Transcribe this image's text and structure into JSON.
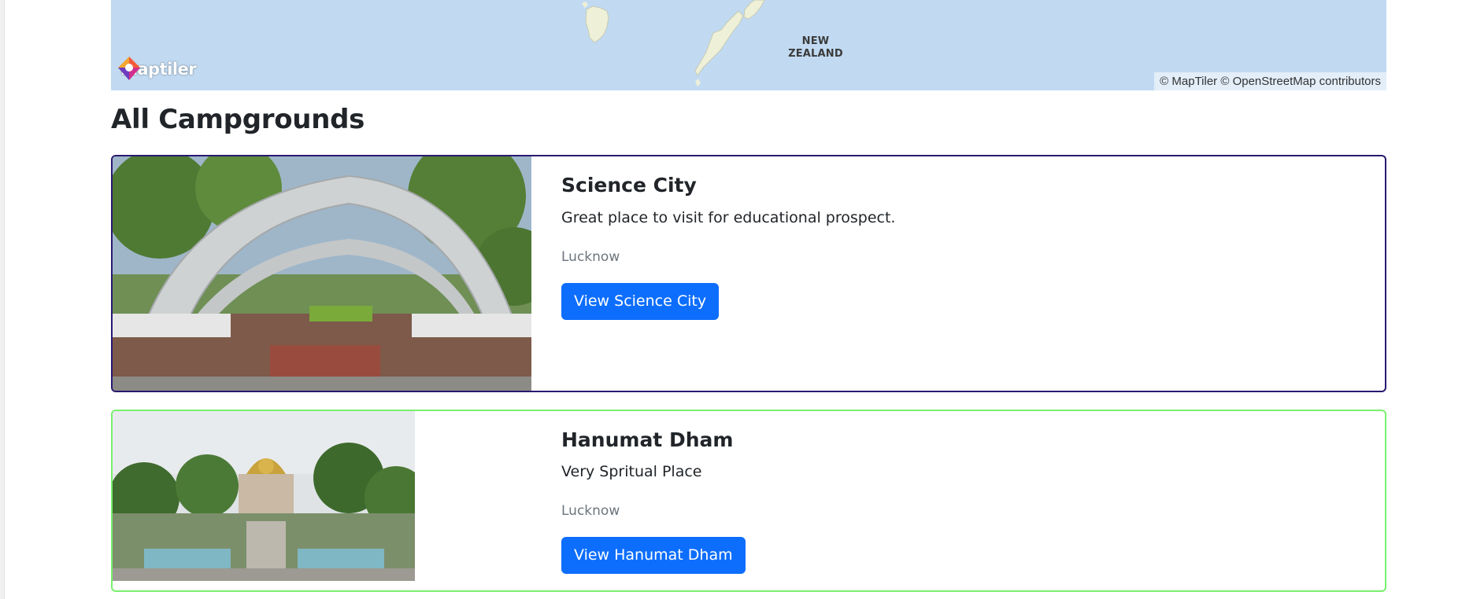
{
  "map": {
    "labels": [
      "NEW",
      "ZEALAND"
    ],
    "logo_text": "maptiler",
    "attribution": "© MapTiler © OpenStreetMap contributors"
  },
  "page_title": "All Campgrounds",
  "campgrounds": [
    {
      "title": "Science City",
      "description": "Great place to visit for educational prospect.",
      "location": "Lucknow",
      "button_label": "View Science City",
      "border_color": "#2a1870"
    },
    {
      "title": "Hanumat Dham",
      "description": "Very Spritual Place",
      "location": "Lucknow",
      "button_label": "View Hanumat Dham",
      "border_color": "#79f06f"
    }
  ],
  "colors": {
    "primary_button": "#0d6efd",
    "map_water": "#c1daf2",
    "muted_text": "#6c757d"
  }
}
